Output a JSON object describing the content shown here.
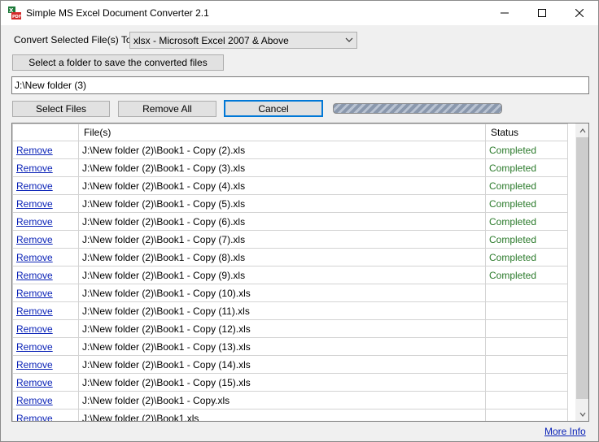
{
  "window": {
    "title": "Simple MS Excel Document Converter 2.1",
    "icon": "excel-pdf-app-icon",
    "controls": [
      "minimize-icon",
      "maximize-icon",
      "close-icon"
    ]
  },
  "convert": {
    "label": "Convert Selected File(s) To",
    "selected_format": "xlsx - Microsoft Excel 2007 & Above"
  },
  "buttons": {
    "select_folder": "Select a folder to save the converted files",
    "select_files": "Select Files",
    "remove_all": "Remove All",
    "cancel": "Cancel"
  },
  "output_path": "J:\\New folder (3)",
  "progress": {
    "state": "indeterminate"
  },
  "file_list": {
    "columns": [
      "",
      "File(s)",
      "Status"
    ],
    "rows": [
      {
        "action": "Remove",
        "file": "J:\\New folder (2)\\Book1 - Copy (2).xls",
        "status": "Completed"
      },
      {
        "action": "Remove",
        "file": "J:\\New folder (2)\\Book1 - Copy (3).xls",
        "status": "Completed"
      },
      {
        "action": "Remove",
        "file": "J:\\New folder (2)\\Book1 - Copy (4).xls",
        "status": "Completed"
      },
      {
        "action": "Remove",
        "file": "J:\\New folder (2)\\Book1 - Copy (5).xls",
        "status": "Completed"
      },
      {
        "action": "Remove",
        "file": "J:\\New folder (2)\\Book1 - Copy (6).xls",
        "status": "Completed"
      },
      {
        "action": "Remove",
        "file": "J:\\New folder (2)\\Book1 - Copy (7).xls",
        "status": "Completed"
      },
      {
        "action": "Remove",
        "file": "J:\\New folder (2)\\Book1 - Copy (8).xls",
        "status": "Completed"
      },
      {
        "action": "Remove",
        "file": "J:\\New folder (2)\\Book1 - Copy (9).xls",
        "status": "Completed"
      },
      {
        "action": "Remove",
        "file": "J:\\New folder (2)\\Book1 - Copy (10).xls",
        "status": ""
      },
      {
        "action": "Remove",
        "file": "J:\\New folder (2)\\Book1 - Copy (11).xls",
        "status": ""
      },
      {
        "action": "Remove",
        "file": "J:\\New folder (2)\\Book1 - Copy (12).xls",
        "status": ""
      },
      {
        "action": "Remove",
        "file": "J:\\New folder (2)\\Book1 - Copy (13).xls",
        "status": ""
      },
      {
        "action": "Remove",
        "file": "J:\\New folder (2)\\Book1 - Copy (14).xls",
        "status": ""
      },
      {
        "action": "Remove",
        "file": "J:\\New folder (2)\\Book1 - Copy (15).xls",
        "status": ""
      },
      {
        "action": "Remove",
        "file": "J:\\New folder (2)\\Book1 - Copy.xls",
        "status": ""
      },
      {
        "action": "Remove",
        "file": "J:\\New folder (2)\\Book1.xls",
        "status": ""
      }
    ]
  },
  "footer": {
    "more_info": "More Info"
  },
  "colors": {
    "link": "#0b23b7",
    "status_completed": "#2b7a2b",
    "focus_border": "#0078d7"
  }
}
